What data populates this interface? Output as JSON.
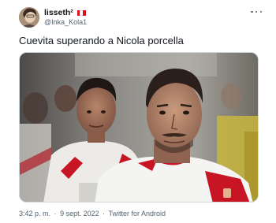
{
  "user": {
    "display_name": "lisseth",
    "name_suffix": "²",
    "handle": "@Inka_Kola1",
    "flag_colors": [
      "#d91023",
      "#ffffff",
      "#d91023"
    ]
  },
  "more_icon": "more-horizontal-icon",
  "tweet": {
    "text": "Cuevita superando a Nicola porcella"
  },
  "media": {
    "kind": "photo",
    "icon": "image"
  },
  "meta": {
    "time": "3:42 p. m.",
    "separator": "·",
    "date": "9 sept. 2022",
    "separator2": "·",
    "source": "Twitter for Android"
  },
  "colors": {
    "text_primary": "#0f1419",
    "text_secondary": "#536471",
    "border": "#cfd9de",
    "jersey_red": "#d91023",
    "jersey_white": "#f4f4f2"
  }
}
